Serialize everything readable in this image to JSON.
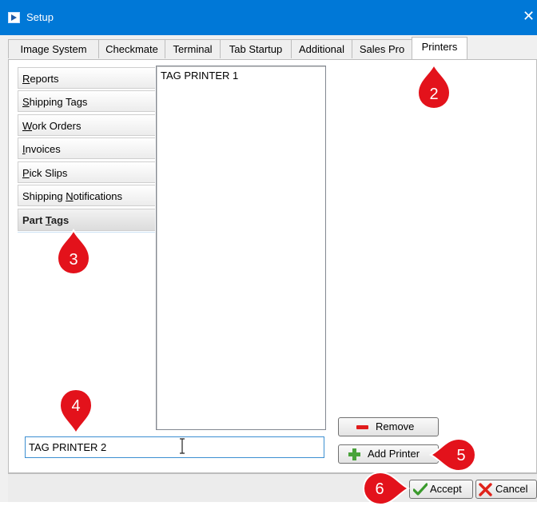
{
  "window": {
    "title": "Setup",
    "close_glyph": "✕",
    "icon": "app-setup-icon"
  },
  "tabs": [
    "Image System",
    "Checkmate",
    "Terminal",
    "Tab Startup",
    "Additional",
    "Sales Pro",
    "Printers"
  ],
  "active_tab": "Printers",
  "categories": [
    {
      "pre": "",
      "u": "R",
      "post": "eports"
    },
    {
      "pre": "",
      "u": "S",
      "post": "hipping Tags"
    },
    {
      "pre": "",
      "u": "W",
      "post": "ork Orders"
    },
    {
      "pre": "",
      "u": "I",
      "post": "nvoices"
    },
    {
      "pre": "",
      "u": "P",
      "post": "ick Slips"
    },
    {
      "pre": "Shipping ",
      "u": "N",
      "post": "otifications"
    },
    {
      "pre": "Part ",
      "u": "T",
      "post": "ags"
    }
  ],
  "active_category": "Part Tags",
  "printer_list": [
    "TAG PRINTER 1"
  ],
  "new_printer_input": {
    "value": "TAG PRINTER 2"
  },
  "buttons": {
    "remove": "Remove",
    "add_printer": "Add Printer",
    "accept": "Accept",
    "cancel": "Cancel"
  },
  "callouts": [
    "2",
    "3",
    "4",
    "5",
    "6"
  ],
  "colors": {
    "titlebar": "#0078d7",
    "callout": "#e3121b",
    "input_focus": "#3c8fd1"
  }
}
